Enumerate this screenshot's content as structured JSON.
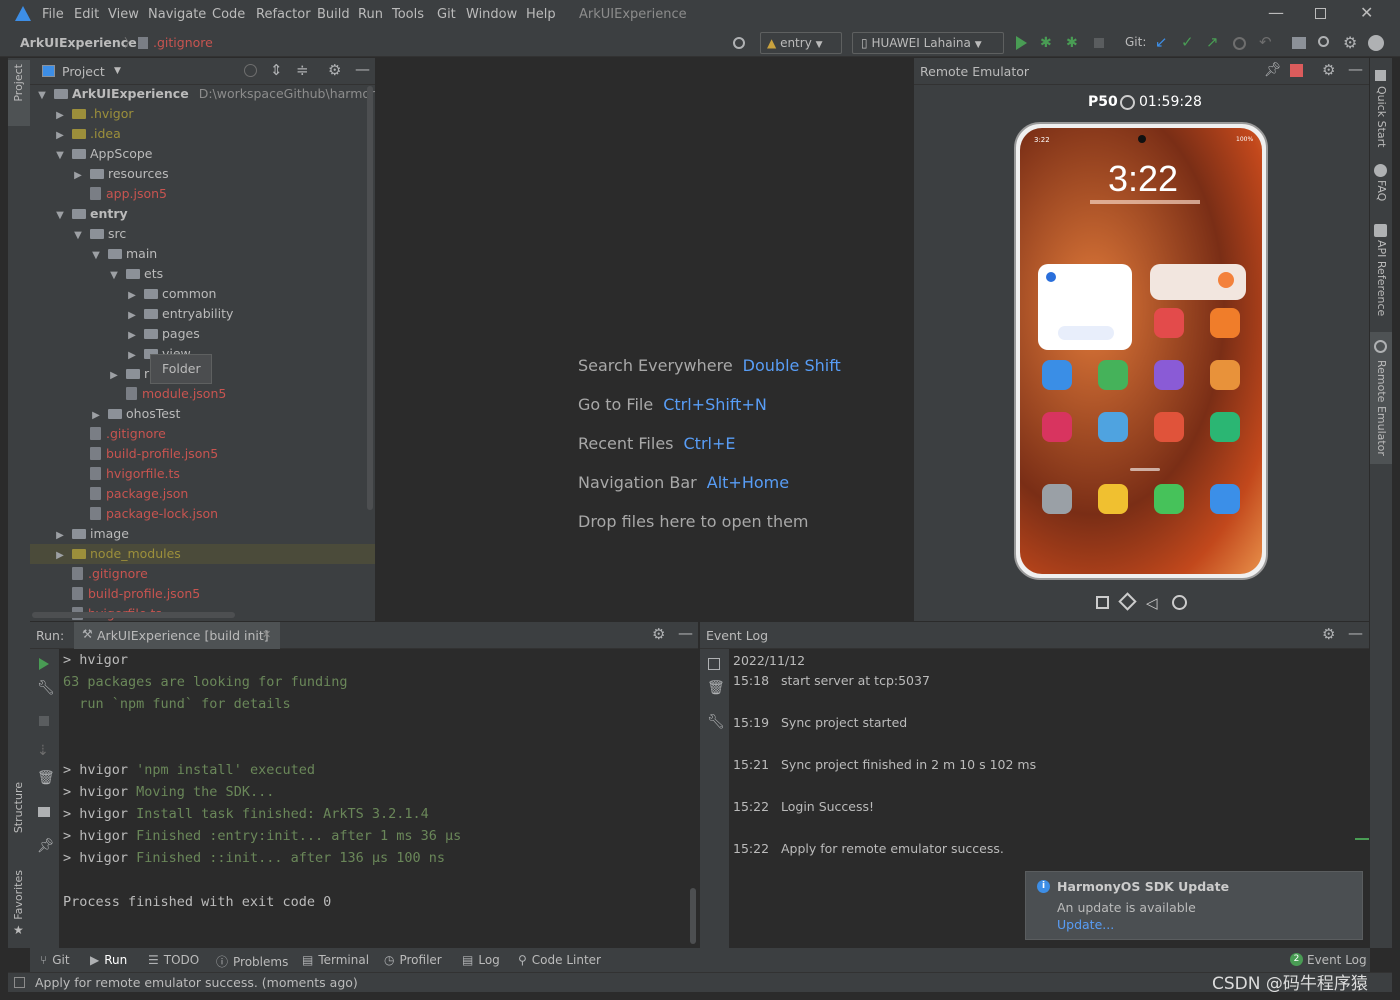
{
  "menu": [
    "File",
    "Edit",
    "View",
    "Navigate",
    "Code",
    "Refactor",
    "Build",
    "Run",
    "Tools",
    "Git",
    "Window",
    "Help"
  ],
  "window_title": "ArkUIExperience",
  "breadcrumb": {
    "project": "ArkUIExperience",
    "file": ".gitignore"
  },
  "toolbar": {
    "module": "entry",
    "device": "HUAWEI Lahaina",
    "git_label": "Git:"
  },
  "project_panel": {
    "title": "Project",
    "root_name": "ArkUIExperience",
    "root_path": "D:\\workspaceGithub\\harmonyos-",
    "tooltip": "Folder",
    "tree": [
      {
        "name": ".hvigor",
        "type": "folder",
        "depth": 1,
        "color": "yel"
      },
      {
        "name": ".idea",
        "type": "folder",
        "depth": 1,
        "color": "yel"
      },
      {
        "name": "AppScope",
        "type": "folder",
        "depth": 1,
        "open": true
      },
      {
        "name": "resources",
        "type": "folder",
        "depth": 2
      },
      {
        "name": "app.json5",
        "type": "file",
        "depth": 2,
        "color": "red"
      },
      {
        "name": "entry",
        "type": "folder",
        "depth": 1,
        "open": true,
        "bold": true
      },
      {
        "name": "src",
        "type": "folder",
        "depth": 2,
        "open": true
      },
      {
        "name": "main",
        "type": "folder",
        "depth": 3,
        "open": true
      },
      {
        "name": "ets",
        "type": "folder",
        "depth": 4,
        "open": true
      },
      {
        "name": "common",
        "type": "folder",
        "depth": 5
      },
      {
        "name": "entryability",
        "type": "folder",
        "depth": 5
      },
      {
        "name": "pages",
        "type": "folder",
        "depth": 5
      },
      {
        "name": "view",
        "type": "folder",
        "depth": 5
      },
      {
        "name": "r",
        "type": "folder",
        "depth": 4
      },
      {
        "name": "module.json5",
        "type": "file",
        "depth": 4,
        "color": "red"
      },
      {
        "name": "ohosTest",
        "type": "folder",
        "depth": 3
      },
      {
        "name": ".gitignore",
        "type": "file",
        "depth": 2,
        "color": "red"
      },
      {
        "name": "build-profile.json5",
        "type": "file",
        "depth": 2,
        "color": "red"
      },
      {
        "name": "hvigorfile.ts",
        "type": "file",
        "depth": 2,
        "color": "red"
      },
      {
        "name": "package.json",
        "type": "file",
        "depth": 2,
        "color": "red"
      },
      {
        "name": "package-lock.json",
        "type": "file",
        "depth": 2,
        "color": "red"
      },
      {
        "name": "image",
        "type": "folder",
        "depth": 1
      },
      {
        "name": "node_modules",
        "type": "folder",
        "depth": 1,
        "color": "yel",
        "highlight": true
      },
      {
        "name": ".gitignore",
        "type": "file",
        "depth": 1,
        "color": "red"
      },
      {
        "name": "build-profile.json5",
        "type": "file",
        "depth": 1,
        "color": "red"
      },
      {
        "name": "hvigorfile.ts",
        "type": "file",
        "depth": 1,
        "color": "red"
      }
    ]
  },
  "editor_hints": [
    {
      "label": "Search Everywhere",
      "key": "Double Shift"
    },
    {
      "label": "Go to File",
      "key": "Ctrl+Shift+N"
    },
    {
      "label": "Recent Files",
      "key": "Ctrl+E"
    },
    {
      "label": "Navigation Bar",
      "key": "Alt+Home"
    },
    {
      "label": "Drop files here to open them",
      "key": ""
    }
  ],
  "emulator": {
    "title": "Remote Emulator",
    "device": "P50",
    "timer": "01:59:28",
    "clock": "3:22",
    "status_time": "3:22",
    "battery": "100%"
  },
  "right_strip": [
    "Quick Start",
    "FAQ",
    "API Reference",
    "Remote Emulator"
  ],
  "left_strip": [
    "Project",
    "Structure",
    "Favorites"
  ],
  "run_panel": {
    "label": "Run:",
    "tab": "ArkUIExperience [build init]",
    "lines": [
      {
        "p": "> hvigor",
        "t": "",
        "c": "wht"
      },
      {
        "p": "",
        "t": "63 packages are looking for funding",
        "c": "grn"
      },
      {
        "p": "",
        "t": "  run `npm fund` for details",
        "c": "grn"
      },
      {
        "p": "",
        "t": "",
        "c": "wht"
      },
      {
        "p": "",
        "t": "",
        "c": "wht"
      },
      {
        "p": "> hvigor ",
        "t": "'npm install' executed",
        "c": "grn"
      },
      {
        "p": "> hvigor ",
        "t": "Moving the SDK...",
        "c": "grn"
      },
      {
        "p": "> hvigor ",
        "t": "Install task finished: ArkTS 3.2.1.4",
        "c": "grn"
      },
      {
        "p": "> hvigor ",
        "t": "Finished :entry:init... after 1 ms 36 μs",
        "c": "grn"
      },
      {
        "p": "> hvigor ",
        "t": "Finished ::init... after 136 μs 100 ns",
        "c": "grn"
      },
      {
        "p": "",
        "t": "",
        "c": "wht"
      },
      {
        "p": "Process finished with exit code 0",
        "t": "",
        "c": "wht"
      }
    ]
  },
  "event_log": {
    "title": "Event Log",
    "date": "2022/11/12",
    "entries": [
      {
        "time": "15:18",
        "msg": "start server at tcp:5037"
      },
      {
        "time": "15:19",
        "msg": "Sync project started"
      },
      {
        "time": "15:21",
        "msg": "Sync project finished in 2 m 10 s 102 ms"
      },
      {
        "time": "15:22",
        "msg": "Login Success!"
      },
      {
        "time": "15:22",
        "msg": "Apply for remote emulator success."
      }
    ]
  },
  "notification": {
    "title": "HarmonyOS SDK Update",
    "body": "An update is available",
    "link": "Update..."
  },
  "bottom_tabs": [
    "Git",
    "Run",
    "TODO",
    "Problems",
    "Terminal",
    "Profiler",
    "Log",
    "Code Linter"
  ],
  "event_log_tab": {
    "count": "2",
    "label": "Event Log"
  },
  "status_text": "Apply for remote emulator success. (moments ago)",
  "watermark": "CSDN @码牛程序猿"
}
